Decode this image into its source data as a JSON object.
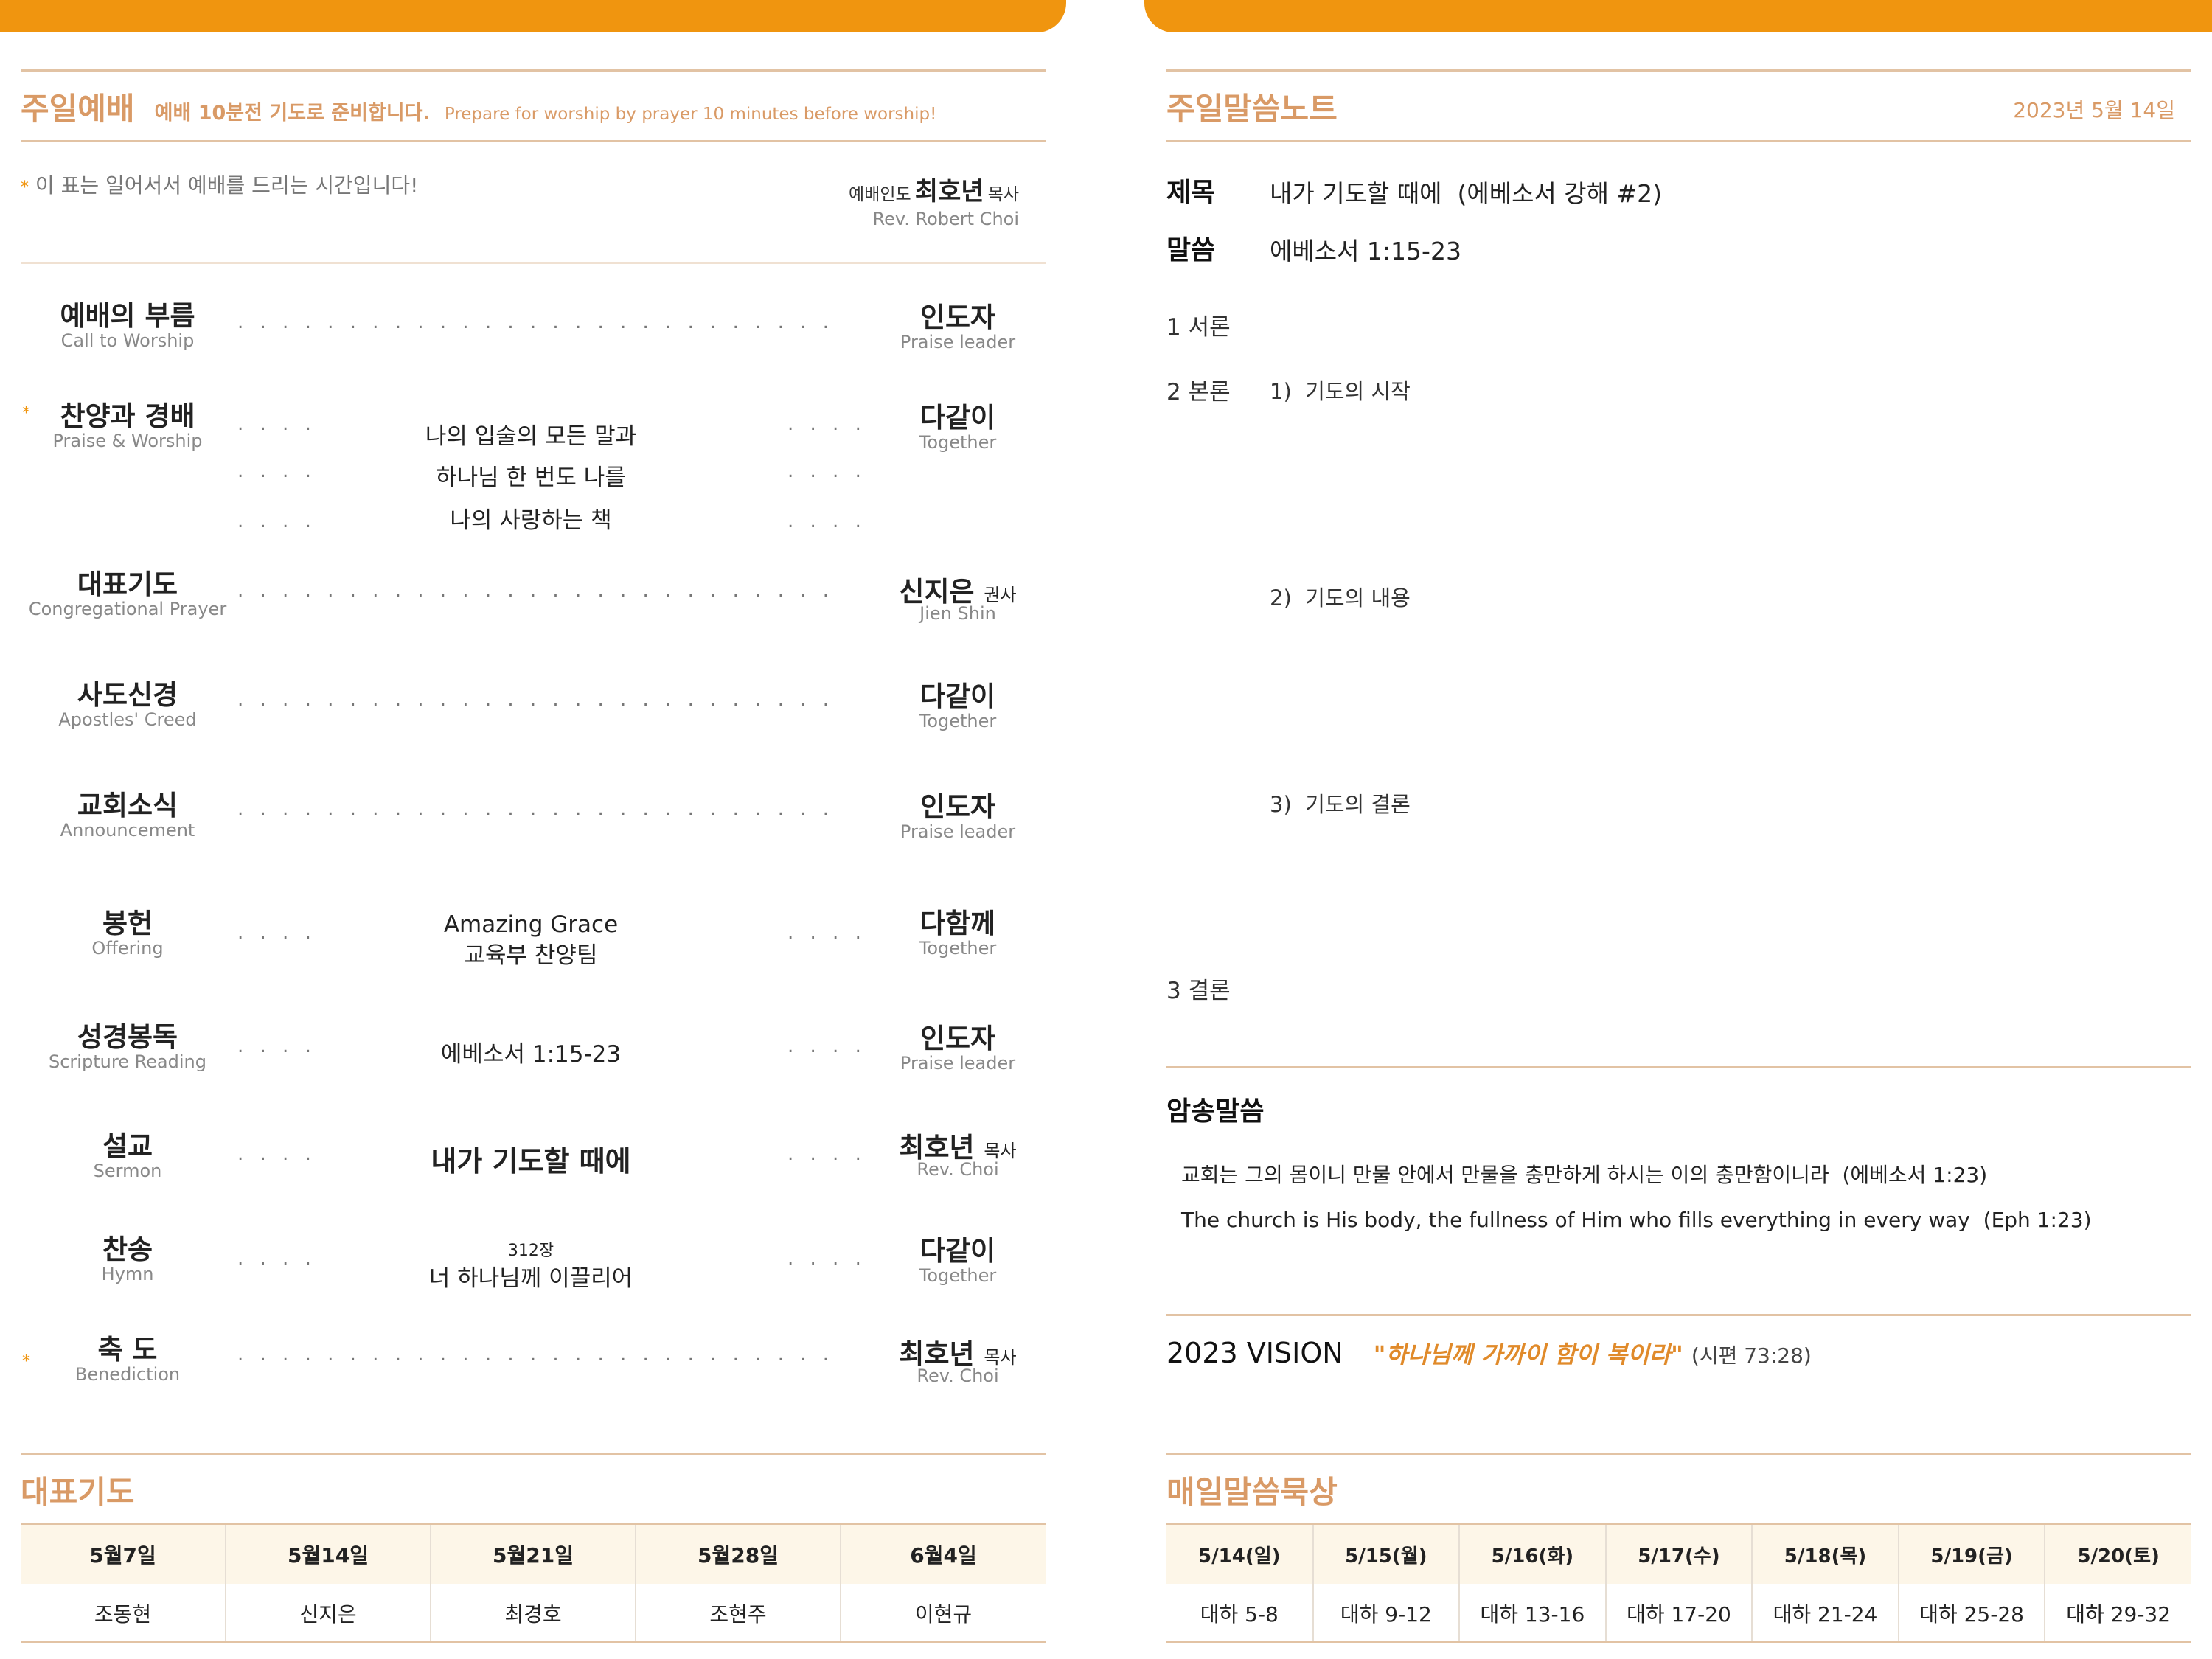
{
  "left": {
    "header": {
      "title": "주일예배",
      "subtitle_kr": "예배 10분전 기도로 준비합니다.",
      "subtitle_en": "Prepare for worship by prayer 10 minutes before worship!"
    },
    "standing_note": "이 표는 일어서서 예배를 드리는 시간입니다!",
    "star_symbol": "*",
    "leader": {
      "role": "예배인도",
      "name": "최호년",
      "title": "목사",
      "name_en": "Rev. Robert Choi"
    },
    "order": [
      {
        "kr": "예배의 부름",
        "en": "Call to Worship",
        "leader_kr": "인도자",
        "leader_en": "Praise leader"
      },
      {
        "kr": "찬양과 경배",
        "en": "Praise & Worship",
        "songs": [
          "나의 입술의 모든 말과",
          "하나님 한 번도 나를",
          "나의 사랑하는 책"
        ],
        "leader_kr": "다같이",
        "leader_en": "Together"
      },
      {
        "kr": "대표기도",
        "en": "Congregational Prayer",
        "leader_kr": "신지은",
        "leader_title": "권사",
        "leader_en": "Jien Shin"
      },
      {
        "kr": "사도신경",
        "en": "Apostles' Creed",
        "leader_kr": "다같이",
        "leader_en": "Together"
      },
      {
        "kr": "교회소식",
        "en": "Announcement",
        "leader_kr": "인도자",
        "leader_en": "Praise leader"
      },
      {
        "kr": "봉헌",
        "en": "Offering",
        "detail_1": "Amazing Grace",
        "detail_2": "교육부 찬양팀",
        "leader_kr": "다함께",
        "leader_en": "Together"
      },
      {
        "kr": "성경봉독",
        "en": "Scripture Reading",
        "detail_1": "에베소서 1:15-23",
        "leader_kr": "인도자",
        "leader_en": "Praise leader"
      },
      {
        "kr": "설교",
        "en": "Sermon",
        "detail_1": "내가 기도할 때에",
        "leader_kr": "최호년",
        "leader_title": "목사",
        "leader_en": "Rev. Choi"
      },
      {
        "kr": "찬송",
        "en": "Hymn",
        "detail_small": "312장",
        "detail_1": "너 하나님께 이끌리어",
        "leader_kr": "다같이",
        "leader_en": "Together"
      },
      {
        "kr": "축 도",
        "en": "Benediction",
        "leader_kr": "최호년",
        "leader_title": "목사",
        "leader_en": "Rev. Choi"
      }
    ],
    "prayer_schedule": {
      "title": "대표기도",
      "dates": [
        "5월7일",
        "5월14일",
        "5월21일",
        "5월28일",
        "6월4일"
      ],
      "names": [
        "조동현",
        "신지은",
        "최경호",
        "조현주",
        "이현규"
      ]
    }
  },
  "right": {
    "header": {
      "title": "주일말씀노트",
      "date": "2023년 5월 14일"
    },
    "sermon": {
      "title_label": "제목",
      "title_value": "내가 기도할 때에  (에베소서 강해 #2)",
      "scripture_label": "말씀",
      "scripture_value": "에베소서 1:15-23"
    },
    "outline": {
      "intro": "1 서론",
      "body": "2 본론",
      "points": [
        "1)  기도의 시작",
        "2)  기도의 내용",
        "3)  기도의 결론"
      ],
      "conclusion": "3 결론"
    },
    "memory": {
      "title": "암송말씀",
      "kr": "교회는 그의 몸이니 만물 안에서 만물을 충만하게 하시는 이의 충만함이니라  (에베소서 1:23)",
      "en": "The church is His body, the fullness of Him who fills everything in every way  (Eph 1:23)"
    },
    "vision": {
      "label": "2023 VISION",
      "quote": "\"하나님께 가까이 함이 복이라\"",
      "ref": "(시편 73:28)"
    },
    "daily": {
      "title": "매일말씀묵상",
      "days": [
        "5/14(일)",
        "5/15(월)",
        "5/16(화)",
        "5/17(수)",
        "5/18(목)",
        "5/19(금)",
        "5/20(토)"
      ],
      "readings": [
        "대하 5-8",
        "대하 9-12",
        "대하 13-16",
        "대하 17-20",
        "대하 21-24",
        "대하 25-28",
        "대하 29-32"
      ]
    }
  },
  "colors": {
    "orange": "#f0950f",
    "header_text": "#d99a66",
    "rule": "#e2c3a4",
    "table_head": "#fdf6e8"
  }
}
